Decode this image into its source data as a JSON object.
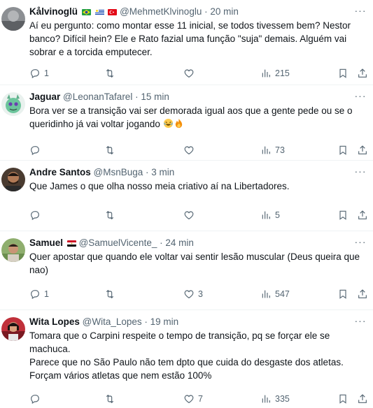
{
  "tweets": [
    {
      "name": "Kålvinoglü",
      "handle": "@MehmetKlvinoglu",
      "time": "· 20 min",
      "text": "Aí eu pergunto: como montar esse 11 inicial, se todos tivessem bem? Nestor banco? Difícil hein? Ele e Rato fazial uma função \"suja\" demais. Alguém vai sobrar e a torcida emputecer.",
      "replies": "1",
      "retweets": "",
      "likes": "",
      "views": "215",
      "flags": [
        "brazil-flag-icon",
        "uruguay-flag-icon",
        "turkey-flag-icon"
      ]
    },
    {
      "name": "Jaguar",
      "handle": "@LeonanTafarel",
      "time": "· 15 min",
      "text": "Bora ver se a transição vai ser demorada igual aos que a gente pede ou se o queridinho já vai voltar jogando",
      "replies": "",
      "retweets": "",
      "likes": "",
      "views": "73",
      "emojis": [
        "laughing-face-emoji-icon",
        "fire-emoji-icon"
      ]
    },
    {
      "name": "Andre Santos",
      "handle": "@MsnBuga",
      "time": "· 3 min",
      "text": "Que James o que olha nosso meia criativo aí na Libertadores.",
      "replies": "",
      "retweets": "",
      "likes": "",
      "views": "5"
    },
    {
      "name": "Samuel",
      "handle": "@SamuelVicente_",
      "time": "· 24 min",
      "text": "Quer apostar que quando ele voltar vai sentir lesão muscular (Deus queira que nao)",
      "replies": "1",
      "retweets": "",
      "likes": "3",
      "views": "547",
      "flags": [
        "egypt-flag-icon"
      ]
    },
    {
      "name": "Wita Lopes",
      "handle": "@Wita_Lopes",
      "time": "· 19 min",
      "text": "Tomara que o Carpini respeite o tempo de transição, pq se forçar ele se machuca.\nParece que no São Paulo não tem dpto que cuida do desgaste dos atletas. Forçam vários atletas que nem estão 100%",
      "replies": "",
      "retweets": "",
      "likes": "7",
      "views": "335"
    }
  ],
  "colors": {
    "text": "#0f1419",
    "secondary": "#536471",
    "divider": "#eff3f4"
  }
}
